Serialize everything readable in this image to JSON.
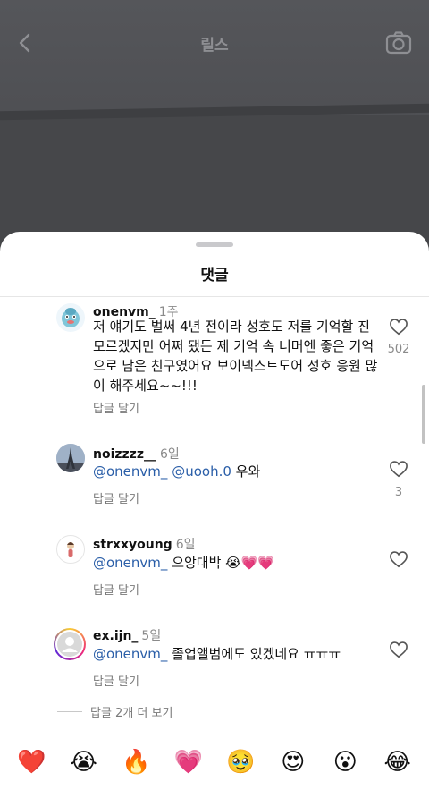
{
  "header": {
    "title": "릴스",
    "back_icon": "‹"
  },
  "sheet": {
    "title": "댓글"
  },
  "comments": [
    {
      "username": "onenvm_",
      "time": "1주",
      "text": "저 얘기도 벌써 4년 전이라 성호도 저를 기억할 진 모르겠지만 어쩌 됐든 제 기억 속 너머엔 좋은 기억으로 남은 친구였어요 보이넥스트도어 성호 응원 많이 해주세요~~!!!",
      "reply_label": "답글 달기",
      "likes": "502"
    },
    {
      "username": "noizzzz__",
      "time": "6일",
      "mention1": "@onenvm_",
      "mention2": "@uooh.0",
      "text": "우와",
      "reply_label": "답글 달기",
      "likes": "3"
    },
    {
      "username": "strxxyoung",
      "time": "6일",
      "mention1": "@onenvm_",
      "text": "으앙대박 😭💗💗",
      "reply_label": "답글 달기"
    },
    {
      "username": "ex.ijn_",
      "time": "5일",
      "mention1": "@onenvm_",
      "text": "졸업앨범에도 있겠네요 ㅠㅠㅠ",
      "reply_label": "답글 달기"
    }
  ],
  "more_replies": "답글 2개 더 보기",
  "reactions": [
    "❤️",
    "😭",
    "🔥",
    "💗",
    "🥹",
    "😍",
    "😮",
    "😂"
  ],
  "colors": {
    "mention": "#2a5ea8",
    "secondary_text": "#8a8a8a"
  }
}
